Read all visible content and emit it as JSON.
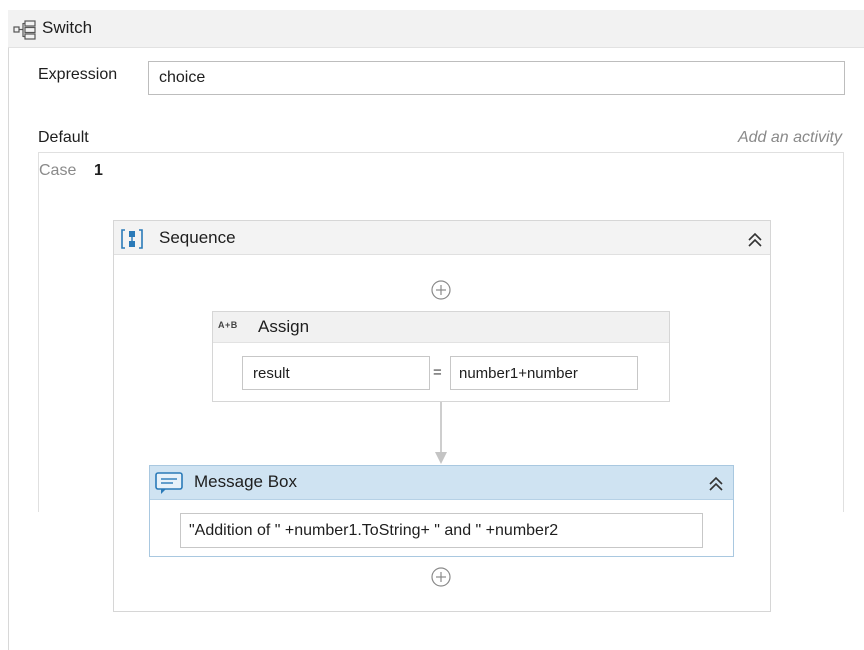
{
  "switch": {
    "title": "Switch",
    "icon": "switch-icon"
  },
  "expression": {
    "label": "Expression",
    "value": "choice"
  },
  "default": {
    "label": "Default",
    "add_activity": "Add an activity"
  },
  "case": {
    "label": "Case",
    "value": "1"
  },
  "sequence": {
    "title": "Sequence",
    "icon": "sequence-icon"
  },
  "assign": {
    "title": "Assign",
    "icon_text": "A+B",
    "left_value": "result",
    "equals": "=",
    "right_value": "number1+number"
  },
  "message_box": {
    "title": "Message Box",
    "icon": "message-icon",
    "text": "\"Addition of \" +number1.ToString+ \" and \"  +number2"
  },
  "colors": {
    "message_header": "#cfe3f2",
    "message_icon": "#2a7ab8",
    "panel_header": "#f2f2f2"
  }
}
